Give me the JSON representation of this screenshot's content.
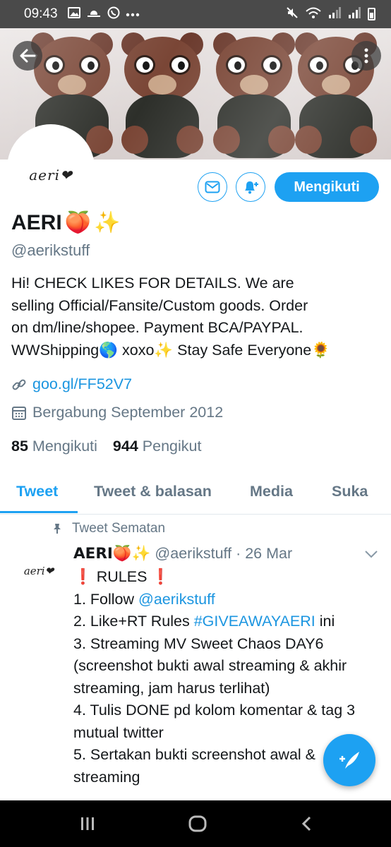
{
  "status_bar": {
    "time": "09:43",
    "icons": [
      "image-icon",
      "weather-icon",
      "whatsapp-icon",
      "more-icon",
      "mute-icon",
      "wifi-icon",
      "signal-icon",
      "signal-icon",
      "battery-icon"
    ]
  },
  "profile": {
    "display_name": "AERI",
    "name_emojis": [
      "🍑",
      "✨"
    ],
    "avatar_text": "aeri❤",
    "handle": "@aerikstuff",
    "bio_lines": [
      "Hi! CHECK LIKES FOR DETAILS. We are",
      "selling Official/Fansite/Custom goods. Order",
      "on dm/line/shopee. Payment BCA/PAYPAL.",
      "WWShipping🌎 xoxo✨ Stay Safe Everyone🌻"
    ],
    "website": "goo.gl/FF52V7",
    "joined": "Bergabung September 2012",
    "following_count": "85",
    "following_label": "Mengikuti",
    "followers_count": "944",
    "followers_label": "Pengikut",
    "follow_button": "Mengikuti"
  },
  "tabs": [
    {
      "label": "Tweet",
      "active": true
    },
    {
      "label": "Tweet & balasan",
      "active": false
    },
    {
      "label": "Media",
      "active": false
    },
    {
      "label": "Suka",
      "active": false
    }
  ],
  "pinned_tweet": {
    "pinned_label": "Tweet Sematan",
    "author_name": "AERI🍑✨",
    "author_handle": "@aerikstuff",
    "date": "· 26 Mar",
    "avatar_text": "aeri❤",
    "lines": [
      {
        "parts": [
          {
            "t": "❗",
            "c": "red"
          },
          {
            "t": " RULES ",
            "c": ""
          },
          {
            "t": "❗",
            "c": "red"
          }
        ]
      },
      {
        "parts": [
          {
            "t": "1. Follow ",
            "c": ""
          },
          {
            "t": "@aerikstuff",
            "c": "link"
          }
        ]
      },
      {
        "parts": [
          {
            "t": "2. Like+RT Rules ",
            "c": ""
          },
          {
            "t": "#GIVEAWAYAERI",
            "c": "link"
          },
          {
            "t": " ini",
            "c": ""
          }
        ]
      },
      {
        "parts": [
          {
            "t": "3. Streaming MV Sweet Chaos DAY6",
            "c": ""
          }
        ]
      },
      {
        "parts": [
          {
            "t": "(screenshot bukti awal streaming & akhir",
            "c": ""
          }
        ]
      },
      {
        "parts": [
          {
            "t": "streaming, jam harus terlihat)",
            "c": ""
          }
        ]
      },
      {
        "parts": [
          {
            "t": "4. Tulis DONE pd kolom komentar & tag 3",
            "c": ""
          }
        ]
      },
      {
        "parts": [
          {
            "t": "mutual twitter",
            "c": ""
          }
        ]
      },
      {
        "parts": [
          {
            "t": "5. Sertakan bukti screenshot awal &",
            "c": ""
          }
        ]
      },
      {
        "parts": [
          {
            "t": "streaming",
            "c": ""
          }
        ]
      }
    ]
  },
  "colors": {
    "accent": "#1da1f2",
    "secondary_text": "#657786",
    "status_bar": "#4a4a4a"
  }
}
